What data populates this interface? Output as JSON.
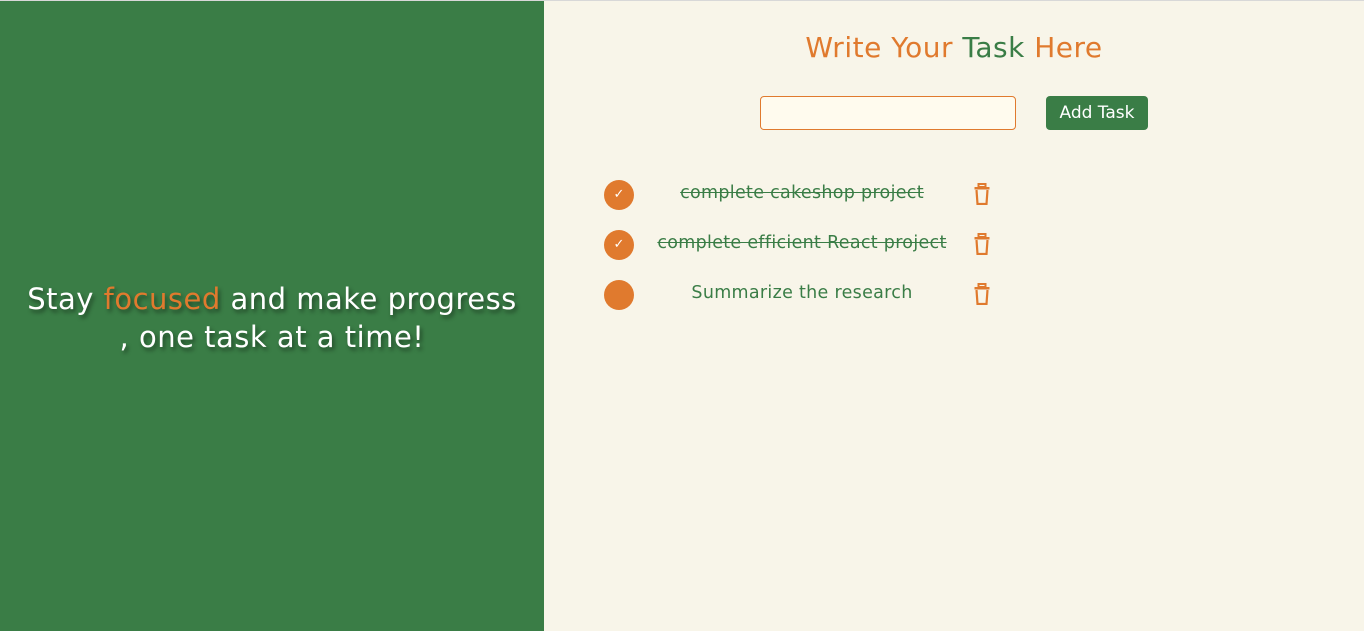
{
  "tagline": {
    "before": "Stay ",
    "accent": "focused",
    "after": " and make progress",
    "line2": ", one task at a time!"
  },
  "heading": {
    "part1": "Write Your ",
    "part2": "Task",
    "part3": " Here"
  },
  "input": {
    "value": "",
    "placeholder": ""
  },
  "add_button": {
    "label": "Add Task"
  },
  "tasks": [
    {
      "text": "complete cakeshop project",
      "completed": true,
      "check_glyph": "✓"
    },
    {
      "text": "complete efficient React project",
      "completed": true,
      "check_glyph": "✓"
    },
    {
      "text": "Summarize the research",
      "completed": false,
      "check_glyph": ""
    }
  ],
  "icons": {
    "check": "check-icon",
    "delete": "trash-icon"
  },
  "colors": {
    "green": "#3a7d46",
    "orange": "#e07a2e",
    "background": "#f8f5e9",
    "input_bg": "#fffbee"
  }
}
